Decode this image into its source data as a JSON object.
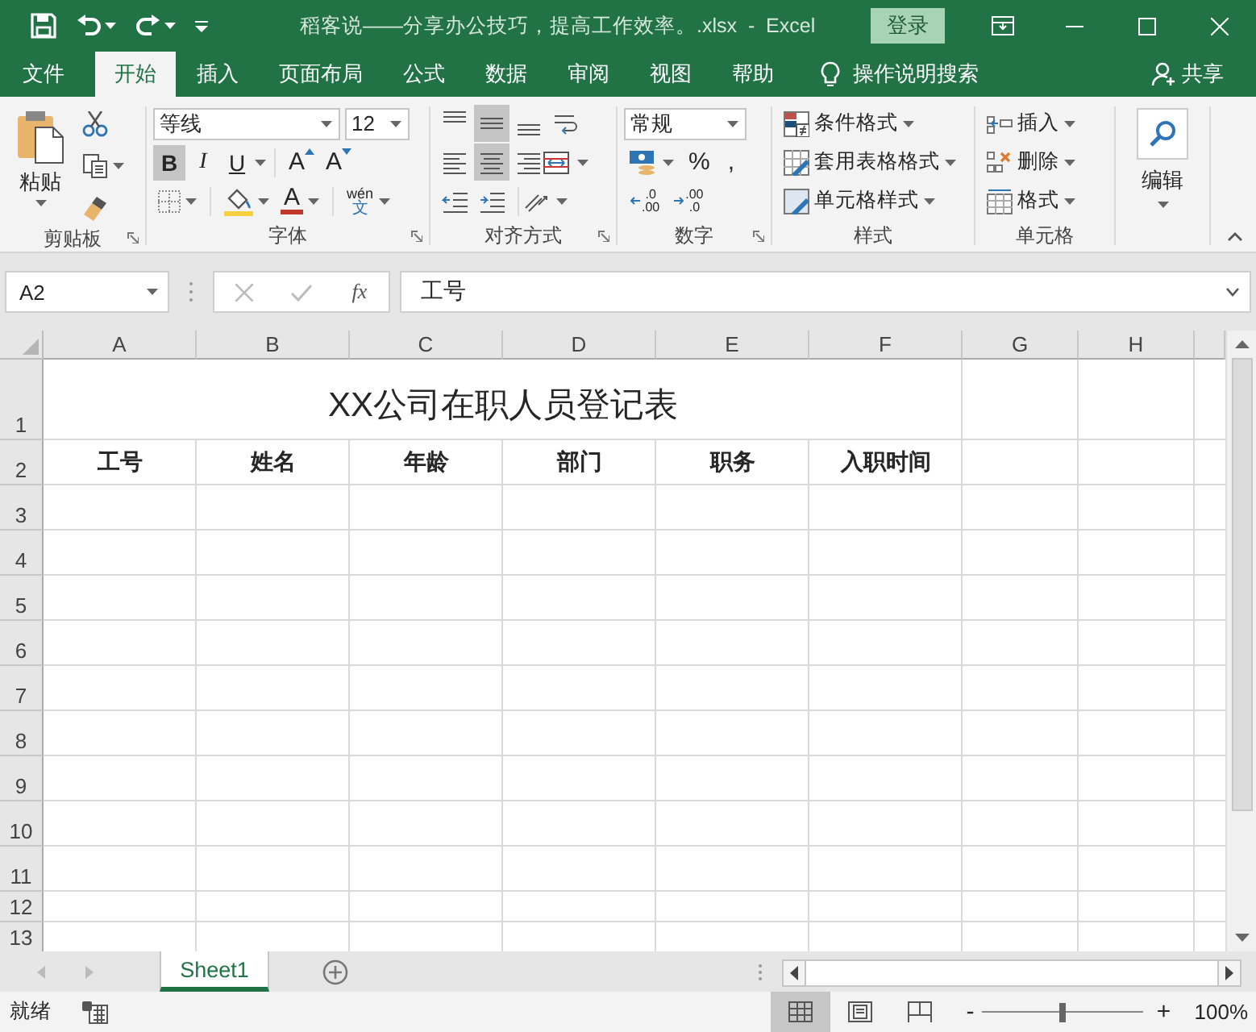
{
  "window": {
    "title": "稻客说——分享办公技巧，提高工作效率。.xlsx  -  Excel",
    "login_button": "登录"
  },
  "tabs": [
    {
      "label": "文件",
      "selected": false
    },
    {
      "label": "开始",
      "selected": true
    },
    {
      "label": "插入",
      "selected": false
    },
    {
      "label": "页面布局",
      "selected": false
    },
    {
      "label": "公式",
      "selected": false
    },
    {
      "label": "数据",
      "selected": false
    },
    {
      "label": "审阅",
      "selected": false
    },
    {
      "label": "视图",
      "selected": false
    },
    {
      "label": "帮助",
      "selected": false
    }
  ],
  "tell_me": "操作说明搜索",
  "share": "共享",
  "ribbon": {
    "clipboard": {
      "paste": "粘贴",
      "label": "剪贴板"
    },
    "font": {
      "name": "等线",
      "size": "12",
      "bold": {
        "text": "B",
        "selected": true
      },
      "italic": {
        "text": "I",
        "selected": false
      },
      "underline": {
        "text": "U",
        "selected": false
      },
      "grow": "A",
      "shrink": "A",
      "color_letter": "A",
      "phonetic": [
        "wén",
        "文"
      ],
      "label": "字体"
    },
    "alignment": {
      "vertical": [
        {
          "selected": false
        },
        {
          "selected": true
        },
        {
          "selected": false
        }
      ],
      "horizontal": [
        {
          "selected": false
        },
        {
          "selected": true
        },
        {
          "selected": false
        }
      ],
      "label": "对齐方式"
    },
    "number": {
      "format": "常规",
      "percent": "%",
      "comma": ",",
      "decimal_up": [
        ".0",
        ".00"
      ],
      "decimal_down": [
        ".00",
        ".0"
      ],
      "label": "数字"
    },
    "styles": {
      "buttons": [
        "条件格式",
        "套用表格格式",
        "单元格样式"
      ],
      "label": "样式"
    },
    "cells": {
      "buttons": [
        "插入",
        "删除",
        "格式"
      ],
      "label": "单元格"
    },
    "editing": {
      "label": "编辑"
    }
  },
  "formula_bar": {
    "name_box": "A2",
    "fx": "fx",
    "formula": "工号"
  },
  "sheet": {
    "columns": [
      "A",
      "B",
      "C",
      "D",
      "E",
      "F",
      "G",
      "H"
    ],
    "rows": [
      "1",
      "2",
      "3",
      "4",
      "5",
      "6",
      "7",
      "8",
      "9",
      "10",
      "11",
      "12",
      "13"
    ],
    "title": "XX公司在职人员登记表",
    "headers": [
      "工号",
      "姓名",
      "年龄",
      "部门",
      "职务",
      "入职时间"
    ]
  },
  "sheet_tabs": [
    {
      "name": "Sheet1",
      "selected": true
    }
  ],
  "status_bar": {
    "text": "就绪",
    "views": [
      {
        "selected": true
      },
      {
        "selected": false
      },
      {
        "selected": false
      }
    ],
    "zoom_out": "-",
    "zoom_in": "+",
    "zoom": {
      "level": 0.5
    },
    "zoom_text": "100%"
  }
}
